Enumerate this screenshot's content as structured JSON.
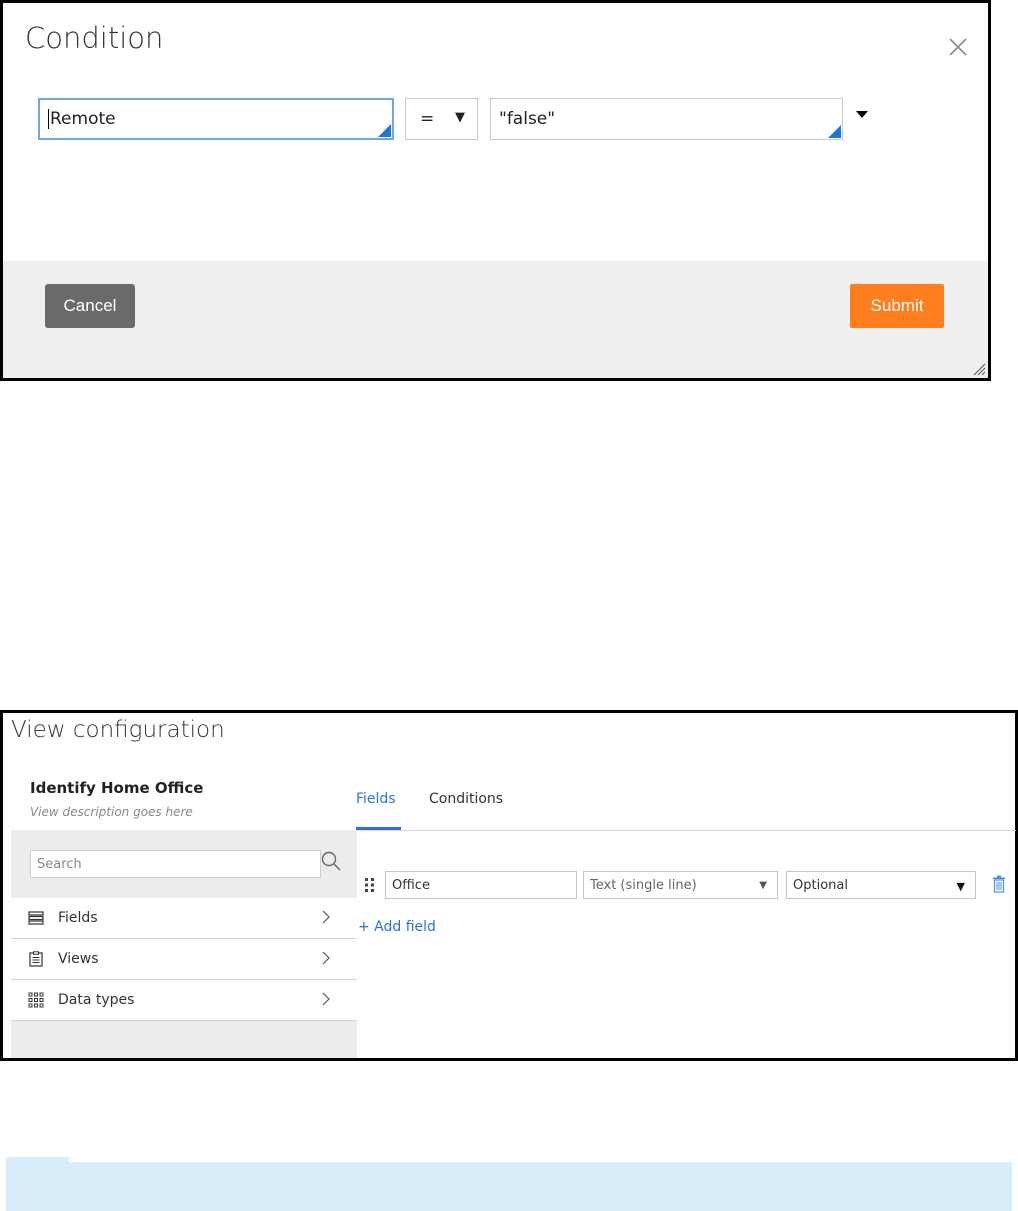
{
  "condition_modal": {
    "title": "Condition",
    "close_icon": "close-icon",
    "left_operand": "Remote",
    "operator": "=",
    "right_operand": "\"false\"",
    "cancel_label": "Cancel",
    "submit_label": "Submit",
    "colors": {
      "submit": "#ff7f1e",
      "cancel": "#6a6a6a",
      "footer": "#efefef",
      "active_border": "#6fa7e3"
    }
  },
  "view_config": {
    "title": "View configuration",
    "view_name": "Identify Home Office",
    "view_description": "View description goes here",
    "tabs": [
      {
        "label": "Fields",
        "active": true
      },
      {
        "label": "Conditions",
        "active": false
      }
    ],
    "search": {
      "placeholder": "Search"
    },
    "sidebar_items": [
      {
        "label": "Fields",
        "icon": "fields-icon"
      },
      {
        "label": "Views",
        "icon": "views-icon"
      },
      {
        "label": "Data types",
        "icon": "data-types-icon"
      }
    ],
    "field_row": {
      "name": "Office",
      "type": "Text (single line)",
      "requirement": "Optional"
    },
    "add_field_label": "+ Add field",
    "colors": {
      "accent": "#2f74c8",
      "sidebar": "#ececec"
    }
  },
  "info_bar": {
    "color": "#d7eefa"
  }
}
